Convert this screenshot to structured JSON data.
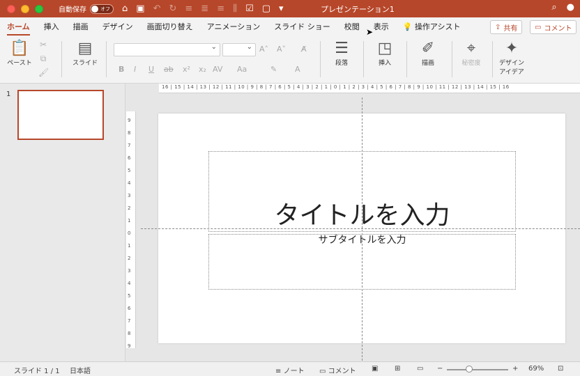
{
  "titlebar": {
    "autosave_label": "自動保存",
    "autosave_state": "オフ",
    "doc_title": "プレゼンテーション1"
  },
  "tabs": [
    {
      "label": "ホーム"
    },
    {
      "label": "挿入"
    },
    {
      "label": "描画"
    },
    {
      "label": "デザイン"
    },
    {
      "label": "画面切り替え"
    },
    {
      "label": "アニメーション"
    },
    {
      "label": "スライド ショー"
    },
    {
      "label": "校閲"
    },
    {
      "label": "表示"
    },
    {
      "label": "操作アシスト"
    }
  ],
  "share_label": "共有",
  "comment_label": "コメント",
  "ribbon": {
    "paste_label": "ペースト",
    "slide_label": "スライド",
    "paragraph_label": "段落",
    "insert_label": "挿入",
    "draw_label": "描画",
    "sensitivity_label": "秘密度",
    "design_ideas_line1": "デザイン",
    "design_ideas_line2": "アイデア"
  },
  "slides_pane": {
    "number": "1"
  },
  "ruler": {
    "horizontal": "16 | 15 | 14 | 13 | 12 | 11 | 10 | 9 | 8 | 7 | 6 | 5 | 4 | 3 | 2 | 1 | 0 | 1 | 2 | 3 | 4 | 5 | 6 | 7 | 8 | 9 | 10 | 11 | 12 | 13 | 14 | 15 | 16",
    "vertical": "9 8 7 6 5 4 3 2 1 0 1 2 3 4 5 6 7 8 9"
  },
  "slide": {
    "title_placeholder": "タイトルを入力",
    "subtitle_placeholder": "サブタイトルを入力"
  },
  "status": {
    "slide_indicator": "スライド 1 / 1",
    "language": "日本語",
    "notes_label": "ノート",
    "comments_label": "コメント",
    "zoom": "69%"
  }
}
